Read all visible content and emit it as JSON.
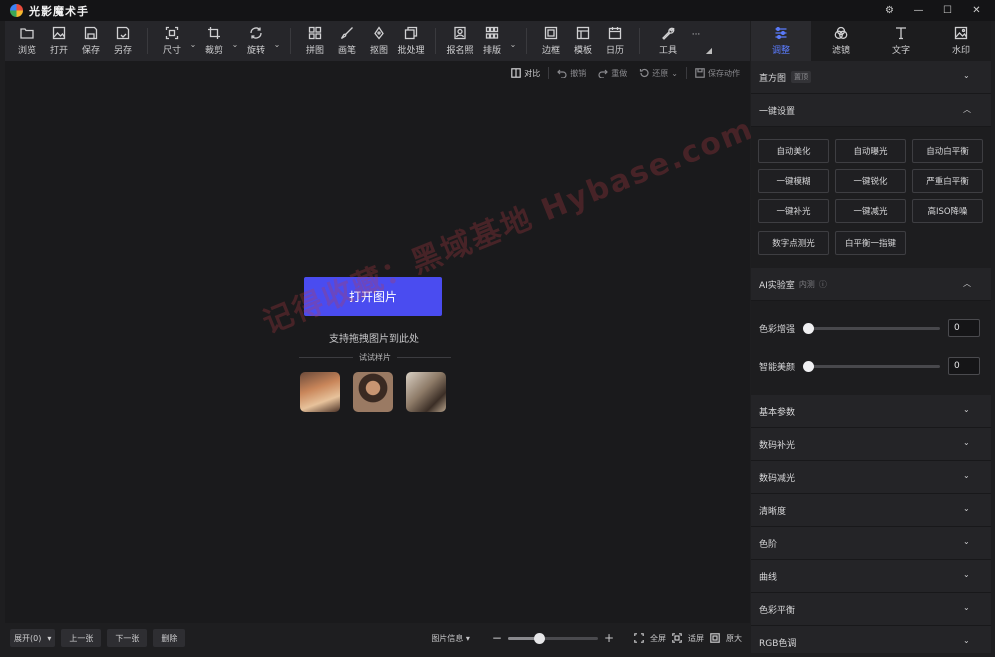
{
  "app": {
    "title": "光影魔术手"
  },
  "window_controls": {
    "settings": "⚙",
    "minimize": "—",
    "maximize": "☐",
    "close": "✕"
  },
  "toolbar": {
    "browse": "浏览",
    "open": "打开",
    "save": "保存",
    "save_as": "另存",
    "size": "尺寸",
    "crop": "裁剪",
    "rotate": "旋转",
    "collage": "拼图",
    "brush": "画笔",
    "cutout": "抠图",
    "batch": "批处理",
    "id_photo": "报名照",
    "layout": "排版",
    "border": "边框",
    "template": "模板",
    "calendar": "日历",
    "tools": "工具",
    "more": "···"
  },
  "right_tabs": {
    "adjust": "调整",
    "filter": "滤镜",
    "text": "文字",
    "watermark": "水印"
  },
  "subbar": {
    "compare": "对比",
    "undo": "撤销",
    "redo": "重做",
    "restore": "还原",
    "save_action": "保存动作"
  },
  "canvas": {
    "open_button": "打开图片",
    "drag_hint": "支持拖拽图片到此处",
    "try_samples": "试试样片",
    "watermark_text": "记得收藏：黑域基地 Hybase.com"
  },
  "bottom": {
    "expand": "展开(0)",
    "prev": "上一张",
    "next": "下一张",
    "delete": "删除",
    "image_info": "图片信息",
    "zoom_minus": "−",
    "zoom_plus": "+",
    "zoom_level": 0.35,
    "fullscreen": "全屏",
    "fit_screen": "适屏",
    "original": "原大"
  },
  "panel": {
    "histogram": {
      "title": "直方图",
      "badge": "置顶"
    },
    "one_click": {
      "title": "一键设置",
      "buttons": [
        [
          "自动美化",
          "自动曝光",
          "自动白平衡"
        ],
        [
          "一键模糊",
          "一键锐化",
          "严重白平衡"
        ],
        [
          "一键补光",
          "一键减光",
          "高ISO降噪"
        ],
        [
          "数字点测光",
          "白平衡一指键"
        ]
      ]
    },
    "ai_lab": {
      "title": "AI实验室",
      "note": "内测",
      "color_enhance": {
        "label": "色彩增强",
        "value": "0"
      },
      "smart_beauty": {
        "label": "智能美颜",
        "value": "0"
      }
    },
    "sections": [
      "基本参数",
      "数码补光",
      "数码减光",
      "清晰度",
      "色阶",
      "曲线",
      "色彩平衡",
      "RGB色调"
    ]
  },
  "colors": {
    "accent": "#4a4cf0",
    "active_tab": "#5b7cff"
  }
}
